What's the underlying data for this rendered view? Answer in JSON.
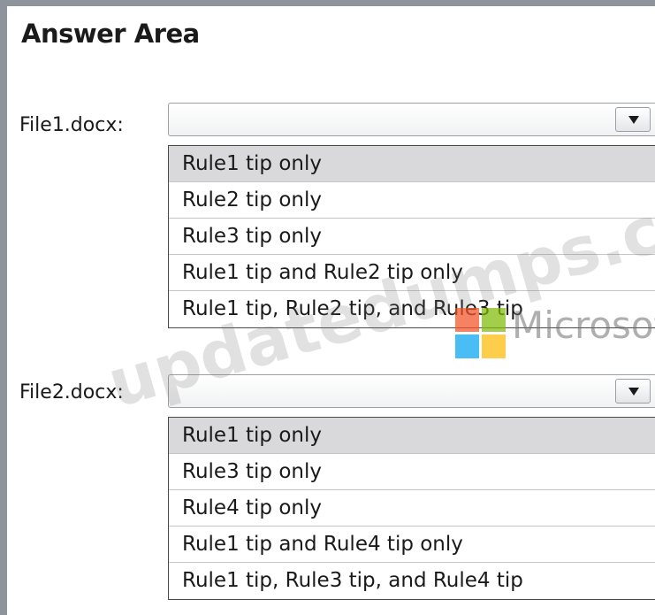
{
  "header": {
    "title": "Answer Area"
  },
  "questions": [
    {
      "label": "File1.docx:",
      "selected_value": "",
      "options": [
        "Rule1 tip only",
        "Rule2 tip only",
        "Rule3 tip only",
        "Rule1 tip and Rule2 tip only",
        "Rule1 tip, Rule2 tip, and Rule3 tip"
      ]
    },
    {
      "label": "File2.docx:",
      "selected_value": "",
      "options": [
        "Rule1 tip only",
        "Rule3 tip only",
        "Rule4 tip only",
        "Rule1 tip and Rule4 tip only",
        "Rule1 tip, Rule3 tip, and Rule4 tip"
      ]
    }
  ],
  "watermark": {
    "text": "updatedumps.com",
    "logo_word": "Microsoft",
    "logo_colors": [
      "#f35325",
      "#81bc06",
      "#05a6f0",
      "#ffba08"
    ]
  },
  "colors": {
    "frame": "#8d949c",
    "highlight": "#d9d9db"
  }
}
